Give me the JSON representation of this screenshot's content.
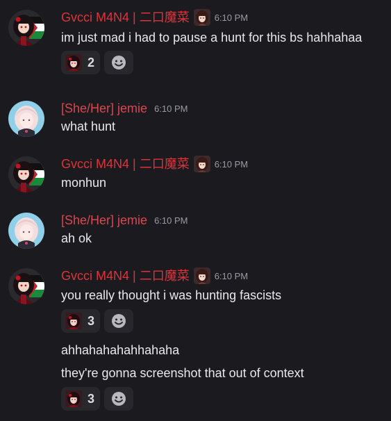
{
  "colors": {
    "user_gvcci": "#e0323a",
    "user_jemie": "#d9474f",
    "background": "#1b1b1f",
    "reaction_bg": "#27272c"
  },
  "groups": [
    {
      "user": "Gvcci M4N4 | 二口魔菜",
      "time": "6:10 PM",
      "avatar_icon": "avatar-gvcci",
      "messages": [
        {
          "text": "im just mad i had to pause a hunt for this bs hahhahaa",
          "reaction_count": "2"
        }
      ]
    },
    {
      "user": "[She/Her] jemie",
      "time": "6:10 PM",
      "avatar_icon": "avatar-jemie",
      "messages": [
        {
          "text": "what hunt"
        }
      ]
    },
    {
      "user": "Gvcci M4N4 | 二口魔菜",
      "time": "6:10 PM",
      "avatar_icon": "avatar-gvcci",
      "messages": [
        {
          "text": "monhun"
        }
      ]
    },
    {
      "user": "[She/Her] jemie",
      "time": "6:10 PM",
      "avatar_icon": "avatar-jemie",
      "messages": [
        {
          "text": "ah ok"
        }
      ]
    },
    {
      "user": "Gvcci M4N4 | 二口魔菜",
      "time": "6:10 PM",
      "avatar_icon": "avatar-gvcci",
      "messages": [
        {
          "text": "you really thought i was hunting fascists",
          "reaction_count": "3"
        },
        {
          "text": "ahhahahahahhahaha"
        },
        {
          "text": "they're gonna screenshot that out of context",
          "reaction_count": "3"
        }
      ]
    }
  ]
}
